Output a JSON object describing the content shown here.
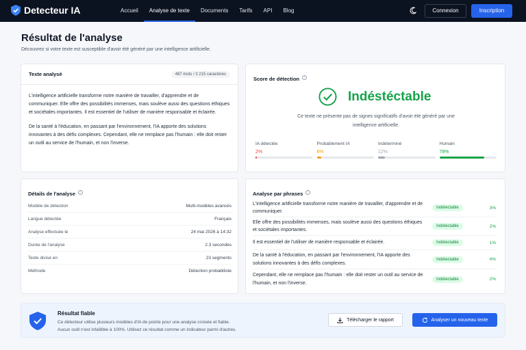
{
  "header": {
    "brand": "Detecteur IA",
    "nav": [
      "Accueil",
      "Analyse de texte",
      "Documents",
      "Tarifs",
      "API",
      "Blog"
    ],
    "active_nav": "Analyse de texte",
    "login": "Connexion",
    "signup": "Inscription"
  },
  "page": {
    "title": "Résultat de l'analyse",
    "subtitle": "Découvrez si votre texte est susceptible d'avoir été généré par une intelligence artificielle."
  },
  "text_card": {
    "title": "Texte analysé",
    "count": "487 mots / 3 215 caractères",
    "paragraphs": [
      "L'intelligence artificielle transforme notre manière de travailler, d'apprendre et de communiquer. Elle offre des possibilités immenses, mais soulève aussi des questions éthiques et sociétales importantes. Il est essentiel de l'utiliser de manière responsable et éclairée.",
      "De la santé à l'éducation, en passant par l'environnement, l'IA apporte des solutions innovantes à des défis complexes. Cependant, elle ne remplace pas l'humain : elle doit rester un outil au service de l'humain, et non l'inverse."
    ]
  },
  "score_card": {
    "title": "Score de détection",
    "verdict": "Indéstéctable",
    "description": "Ce texte ne présente pas de signes significatifs d'avoir été généré par une intelligence artificielle.",
    "metrics": [
      {
        "label": "IA détectée",
        "value": "2%",
        "fraction": 0.02,
        "color": "#ef4444"
      },
      {
        "label": "Probablement IA",
        "value": "8%",
        "fraction": 0.08,
        "color": "#f59e0b"
      },
      {
        "label": "Indéterminé",
        "value": "12%",
        "fraction": 0.12,
        "color": "#9ca3af"
      },
      {
        "label": "Humain",
        "value": "78%",
        "fraction": 0.78,
        "color": "#16a34a"
      }
    ]
  },
  "details_card": {
    "title": "Détails de l'analyse",
    "rows": [
      {
        "label": "Modèle de détection",
        "value": "Multi-modèles avancés"
      },
      {
        "label": "Langue détectée",
        "value": "Français"
      },
      {
        "label": "Analyse effectuée le",
        "value": "24 mai 2026 à 14:32"
      },
      {
        "label": "Durée de l'analyse",
        "value": "2.3 secondes"
      },
      {
        "label": "Texte divisé en",
        "value": "23 segments"
      },
      {
        "label": "Méthode",
        "value": "Détection probabiliste"
      }
    ]
  },
  "phrases_card": {
    "title": "Analyse par phrases",
    "rows": [
      {
        "text": "L'intelligence artificielle transforme notre manière de travailler, d'apprendre et de communiquer.",
        "status": "Indétectable",
        "pct": "3%"
      },
      {
        "text": "Elle offre des possibilités immenses, mais soulève aussi des questions éthiques et sociétales importantes.",
        "status": "Indétectable",
        "pct": "2%"
      },
      {
        "text": "Il est essentiel de l'utiliser de manière responsable et éclairée.",
        "status": "Indétectable",
        "pct": "1%"
      },
      {
        "text": "De la santé à l'éducation, en passant par l'environnement, l'IA apporte des solutions innovantes à des défis complexes.",
        "status": "Indétectable",
        "pct": "4%"
      },
      {
        "text": "Cependant, elle ne remplace pas l'humain : elle doit rester un outil au service de l'humain, et non l'inverse.",
        "status": "Indétectable",
        "pct": "2%"
      }
    ]
  },
  "bottom": {
    "title": "Résultat fiable",
    "desc_line1": "Ce détecteur utilise plusieurs modèles d'IA de pointe pour une analyse croisée et fiable.",
    "desc_line2": "Aucun outil n'est infaillible à 100%. Utilisez ce résultat comme un indicateur parmi d'autres.",
    "download": "Télécharger le rapport",
    "new_analysis": "Analyser un nouveau texte"
  },
  "icons": [
    "shield-logo-icon",
    "moon-icon",
    "info-icon",
    "check-circle-icon",
    "shield-check-icon",
    "download-icon",
    "refresh-icon"
  ],
  "colors": {
    "accent": "#2563eb",
    "success": "#16a34a",
    "topbar": "#0b1220"
  }
}
